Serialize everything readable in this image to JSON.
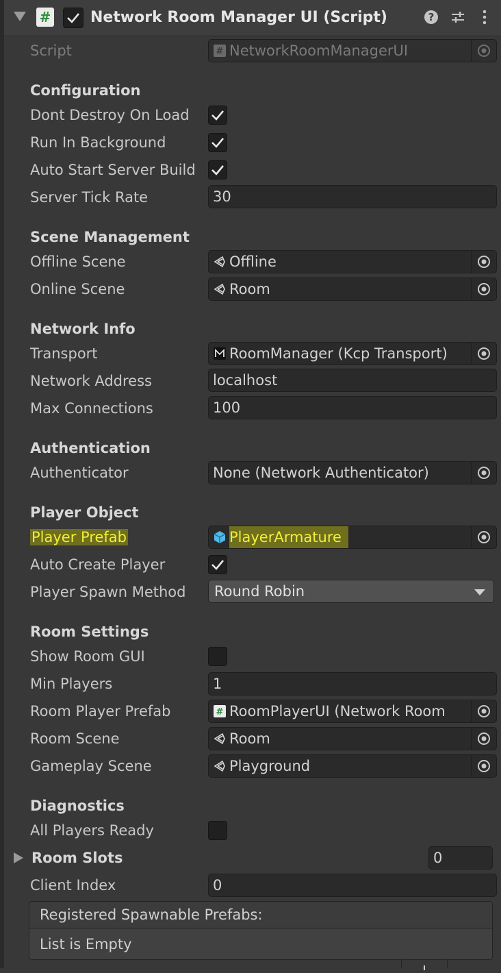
{
  "header": {
    "title": "Network Room Manager UI (Script)",
    "enabled": true,
    "script_icon_glyph": "#"
  },
  "script_field": {
    "label": "Script",
    "value": "NetworkRoomManagerUI"
  },
  "configuration": {
    "heading": "Configuration",
    "dont_destroy_label": "Dont Destroy On Load",
    "run_background_label": "Run In Background",
    "auto_start_label": "Auto Start Server Build",
    "tick_rate_label": "Server Tick Rate",
    "tick_rate_value": "30"
  },
  "scene_management": {
    "heading": "Scene Management",
    "offline_label": "Offline Scene",
    "offline_value": "Offline",
    "online_label": "Online Scene",
    "online_value": "Room"
  },
  "network_info": {
    "heading": "Network Info",
    "transport_label": "Transport",
    "transport_value": "RoomManager (Kcp Transport)",
    "address_label": "Network Address",
    "address_value": "localhost",
    "max_conn_label": "Max Connections",
    "max_conn_value": "100"
  },
  "authentication": {
    "heading": "Authentication",
    "authenticator_label": "Authenticator",
    "authenticator_value": "None (Network Authenticator)"
  },
  "player_object": {
    "heading": "Player Object",
    "prefab_label": "Player Prefab",
    "prefab_value": "PlayerArmature",
    "auto_create_label": "Auto Create Player",
    "spawn_label": "Player Spawn Method",
    "spawn_value": "Round Robin"
  },
  "room_settings": {
    "heading": "Room Settings",
    "show_gui_label": "Show Room GUI",
    "min_players_label": "Min Players",
    "min_players_value": "1",
    "room_player_label": "Room Player Prefab",
    "room_player_value": "RoomPlayerUI (Network Room",
    "room_scene_label": "Room Scene",
    "room_scene_value": "Room",
    "gameplay_label": "Gameplay Scene",
    "gameplay_value": "Playground"
  },
  "diagnostics": {
    "heading": "Diagnostics",
    "all_ready_label": "All Players Ready",
    "room_slots_label": "Room Slots",
    "room_slots_value": "0",
    "client_index_label": "Client Index",
    "client_index_value": "0"
  },
  "spawnable": {
    "header": "Registered Spawnable Prefabs:",
    "empty": "List is Empty"
  },
  "colors": {
    "background": "#383838",
    "field": "#2a2a2a",
    "highlight": "#f0ef3a"
  }
}
